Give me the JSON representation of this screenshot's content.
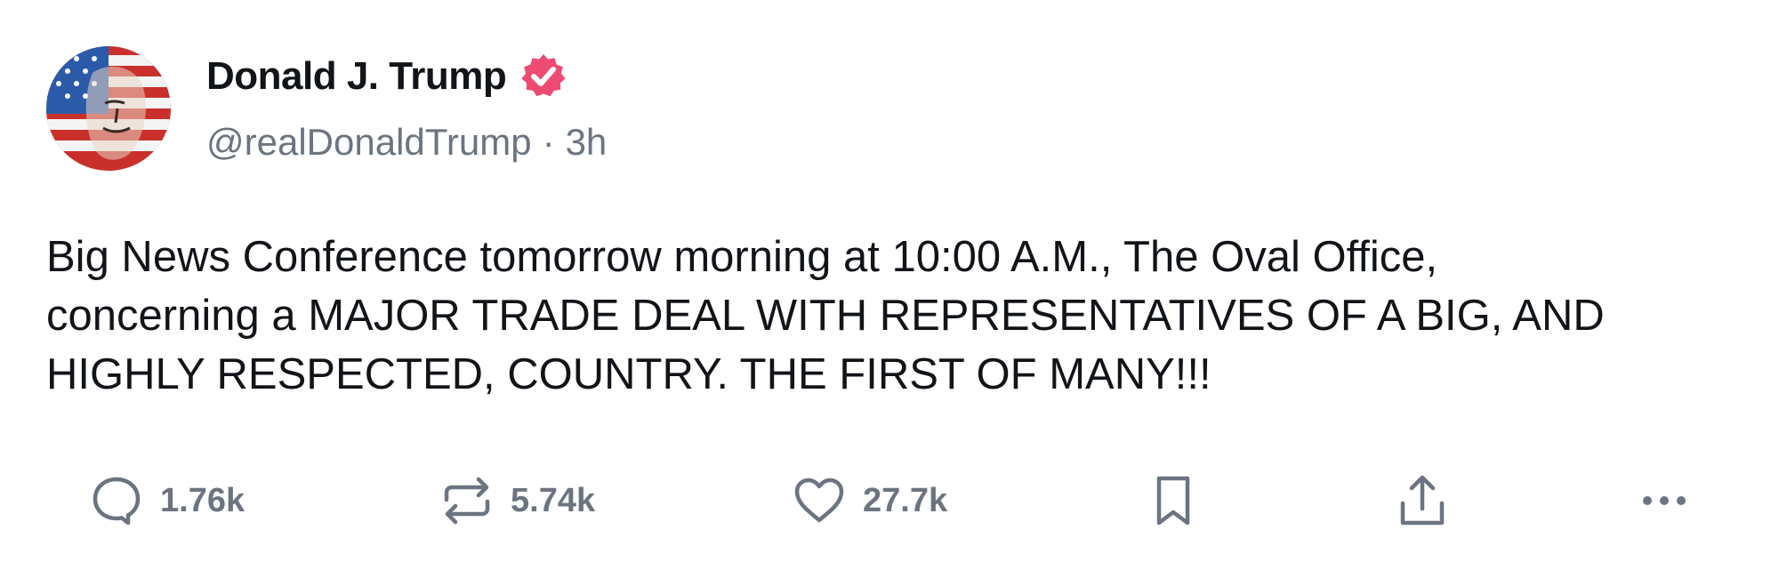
{
  "author": {
    "display_name": "Donald J. Trump",
    "handle": "@realDonaldTrump",
    "separator": "·",
    "time_ago": "3h",
    "verified_color": "#ee4b73"
  },
  "post": {
    "text": "Big News Conference tomorrow morning at 10:00 A.M., The Oval Office,\nconcerning a MAJOR TRADE DEAL WITH REPRESENTATIVES OF A BIG, AND\nHIGHLY RESPECTED, COUNTRY. THE FIRST OF MANY!!!"
  },
  "actions": {
    "replies": "1.76k",
    "reposts": "5.74k",
    "likes": "27.7k",
    "icons": [
      "reply-icon",
      "repost-icon",
      "heart-icon",
      "bookmark-icon",
      "share-icon",
      "more-icon"
    ]
  },
  "colors": {
    "text": "#111418",
    "muted": "#6b7480",
    "verified_badge": "#ee4b73"
  }
}
